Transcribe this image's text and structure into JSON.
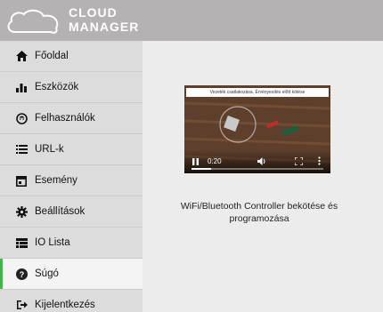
{
  "app": {
    "logo_line1": "CLOUD",
    "logo_line2": "MANAGER"
  },
  "sidebar": {
    "items": [
      {
        "label": "Főoldal",
        "icon": "home-icon"
      },
      {
        "label": "Eszközök",
        "icon": "bar-chart-icon"
      },
      {
        "label": "Felhasználók",
        "icon": "user-face-icon"
      },
      {
        "label": "URL-k",
        "icon": "list-icon"
      },
      {
        "label": "Esemény",
        "icon": "calendar-icon"
      },
      {
        "label": "Beállítások",
        "icon": "gear-icon"
      },
      {
        "label": "IO Lista",
        "icon": "table-list-icon"
      },
      {
        "label": "Súgó",
        "icon": "help-icon",
        "active": true
      },
      {
        "label": "Kijelentkezés",
        "icon": "logout-icon"
      }
    ]
  },
  "video": {
    "caption": "Vezeték csatlakozása. Érvényesítés előtt kötése",
    "time": "0:20",
    "progress": 0.15
  },
  "main": {
    "description": "WiFi/Bluetooth Controller bekötése és programozása"
  },
  "colors": {
    "accent": "#43b54a",
    "header": "#b4b2b2",
    "sidebar": "#dcdcdc"
  }
}
